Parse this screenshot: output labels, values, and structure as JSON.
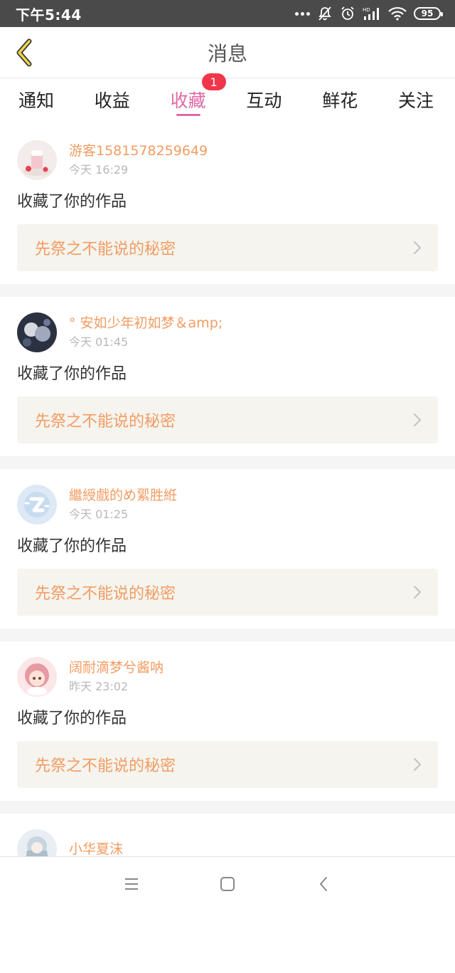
{
  "status_bar": {
    "time": "下午5:44",
    "battery": "95",
    "icons": [
      "more-dots-icon",
      "mute-icon",
      "alarm-icon",
      "hd-signal-icon",
      "wifi-icon",
      "battery-icon"
    ]
  },
  "header": {
    "title": "消息",
    "back_icon": "chevron-left-icon"
  },
  "tabs": [
    {
      "label": "通知",
      "active": false
    },
    {
      "label": "收益",
      "active": false
    },
    {
      "label": "收藏",
      "active": true,
      "badge": "1"
    },
    {
      "label": "互动",
      "active": false
    },
    {
      "label": "鲜花",
      "active": false
    },
    {
      "label": "关注",
      "active": false
    }
  ],
  "colors": {
    "accent": "#e069a6",
    "username": "#f29c62",
    "badge": "#f1364a",
    "card_bg": "#f5f4ee"
  },
  "notifications": [
    {
      "username": "游客1581578259649",
      "time": "今天 16:29",
      "action": "收藏了你的作品",
      "work": "先祭之不能说的秘密"
    },
    {
      "username": "° 安如少年初如梦＆amp;",
      "time": "今天 01:45",
      "action": "收藏了你的作品",
      "work": "先祭之不能说的秘密"
    },
    {
      "username": "繼綬戲的め綤胜絍",
      "time": "今天 01:25",
      "action": "收藏了你的作品",
      "work": "先祭之不能说的秘密"
    },
    {
      "username": "阔耐滴梦兮酱呐",
      "time": "昨天 23:02",
      "action": "收藏了你的作品",
      "work": "先祭之不能说的秘密"
    },
    {
      "username": "小华夏沫",
      "time": "",
      "action": "",
      "work": ""
    }
  ],
  "nav_bar": [
    "menu-icon",
    "home-icon",
    "back-icon"
  ]
}
